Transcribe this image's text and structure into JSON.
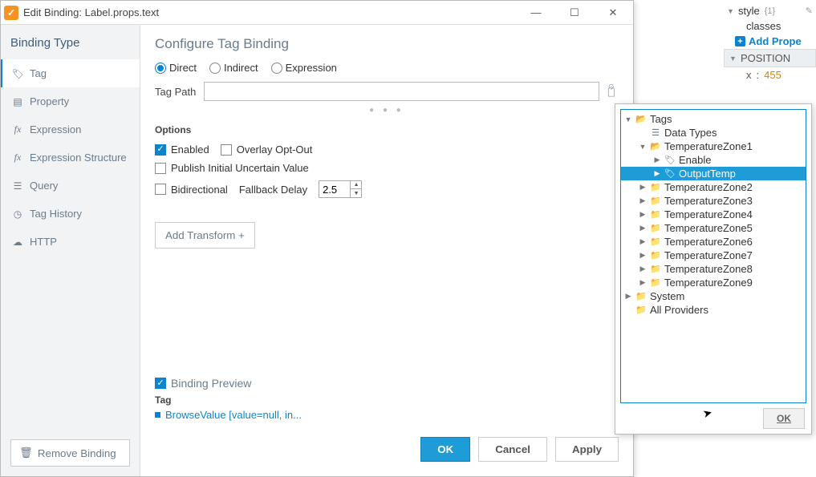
{
  "window": {
    "title": "Edit Binding: Label.props.text"
  },
  "sidebar": {
    "title": "Binding Type",
    "items": [
      {
        "label": "Tag",
        "icon": "tag-icon"
      },
      {
        "label": "Property",
        "icon": "property-icon"
      },
      {
        "label": "Expression",
        "icon": "fx-icon"
      },
      {
        "label": "Expression Structure",
        "icon": "fx-icon"
      },
      {
        "label": "Query",
        "icon": "db-icon"
      },
      {
        "label": "Tag History",
        "icon": "history-icon"
      },
      {
        "label": "HTTP",
        "icon": "cloud-icon"
      }
    ],
    "remove": "Remove Binding"
  },
  "main": {
    "title": "Configure Tag Binding",
    "radios": {
      "direct": "Direct",
      "indirect": "Indirect",
      "expression": "Expression",
      "selected": "direct"
    },
    "tagpath_label": "Tag Path",
    "tagpath_value": "",
    "options_label": "Options",
    "options": {
      "enabled": {
        "label": "Enabled",
        "checked": true
      },
      "overlay": {
        "label": "Overlay Opt-Out",
        "checked": false
      },
      "publish": {
        "label": "Publish Initial Uncertain Value",
        "checked": false
      },
      "bidir": {
        "label": "Bidirectional",
        "checked": false
      },
      "fallback_label": "Fallback Delay",
      "fallback_value": "2.5"
    },
    "add_transform": "Add Transform +",
    "preview": {
      "title": "Binding Preview",
      "tag_label": "Tag",
      "value": "BrowseValue [value=null, in..."
    },
    "footer": {
      "ok": "OK",
      "cancel": "Cancel",
      "apply": "Apply"
    }
  },
  "tree": {
    "nodes": [
      {
        "label": "Tags",
        "depth": 0,
        "toggle": "▼",
        "icon": "folder-open-icon"
      },
      {
        "label": "Data Types",
        "depth": 1,
        "toggle": "",
        "icon": "types-icon"
      },
      {
        "label": "TemperatureZone1",
        "depth": 1,
        "toggle": "▼",
        "icon": "folder-open-icon"
      },
      {
        "label": "Enable",
        "depth": 2,
        "toggle": "▶",
        "icon": "tag-icon"
      },
      {
        "label": "OutputTemp",
        "depth": 2,
        "toggle": "▶",
        "icon": "tag-icon",
        "selected": true
      },
      {
        "label": "TemperatureZone2",
        "depth": 1,
        "toggle": "▶",
        "icon": "folder-icon"
      },
      {
        "label": "TemperatureZone3",
        "depth": 1,
        "toggle": "▶",
        "icon": "folder-icon"
      },
      {
        "label": "TemperatureZone4",
        "depth": 1,
        "toggle": "▶",
        "icon": "folder-icon"
      },
      {
        "label": "TemperatureZone5",
        "depth": 1,
        "toggle": "▶",
        "icon": "folder-icon"
      },
      {
        "label": "TemperatureZone6",
        "depth": 1,
        "toggle": "▶",
        "icon": "folder-icon"
      },
      {
        "label": "TemperatureZone7",
        "depth": 1,
        "toggle": "▶",
        "icon": "folder-icon"
      },
      {
        "label": "TemperatureZone8",
        "depth": 1,
        "toggle": "▶",
        "icon": "folder-icon"
      },
      {
        "label": "TemperatureZone9",
        "depth": 1,
        "toggle": "▶",
        "icon": "folder-icon"
      },
      {
        "label": "System",
        "depth": 0,
        "toggle": "▶",
        "icon": "folder-icon"
      },
      {
        "label": "All Providers",
        "depth": 0,
        "toggle": "",
        "icon": "folder-icon"
      }
    ],
    "ok": "OK"
  },
  "right": {
    "style_label": "style",
    "style_badge": "{1}",
    "classes_label": "classes",
    "add_prop": "Add Prope",
    "section": "POSITION",
    "xkey": "x",
    "xval": "455"
  }
}
